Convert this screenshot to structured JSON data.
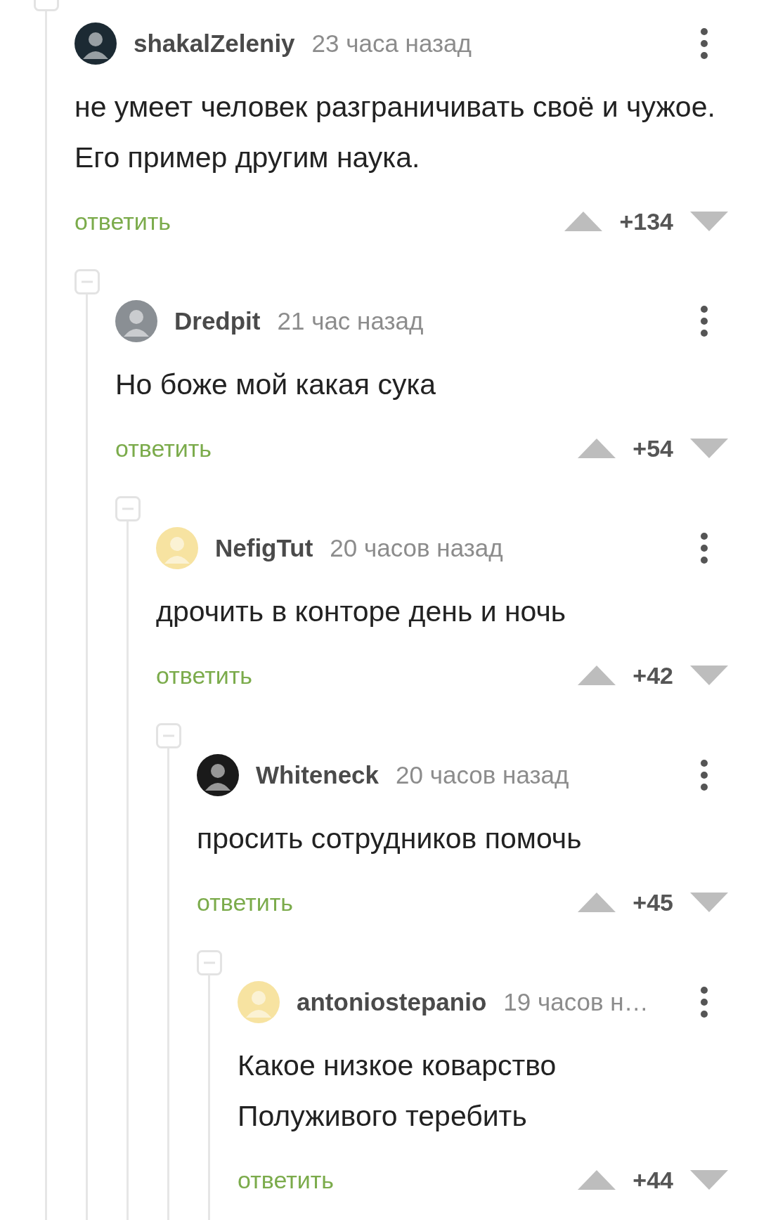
{
  "comments": [
    {
      "author": "shakalZeleniy",
      "time": "23 часа назад",
      "color": "#1c2a33",
      "text": "не умеет человек разграничивать своё и чужое. Его пример другим наука.",
      "reply": "ответить",
      "score": "+134",
      "children": [
        {
          "author": "Dredpit",
          "time": "21 час назад",
          "color": "#8a8f94",
          "text": "Но боже мой какая сука",
          "reply": "ответить",
          "score": "+54",
          "children": [
            {
              "author": "NefigTut",
              "time": "20 часов назад",
              "color": "#f7e3a1",
              "text": "дрочить в конторе день и ночь",
              "reply": "ответить",
              "score": "+42",
              "children": [
                {
                  "author": "Whiteneck",
                  "time": "20 часов назад",
                  "color": "#1a1a1a",
                  "text": "просить сотрудников помочь",
                  "reply": "ответить",
                  "score": "+45",
                  "children": [
                    {
                      "author": "antoniostepanio",
                      "time": "19 часов н…",
                      "color": "#f7e3a1",
                      "text": "Какое низкое коварство\nПолуживого теребить",
                      "reply": "ответить",
                      "score": "+44"
                    }
                  ]
                }
              ]
            }
          ]
        }
      ]
    }
  ]
}
